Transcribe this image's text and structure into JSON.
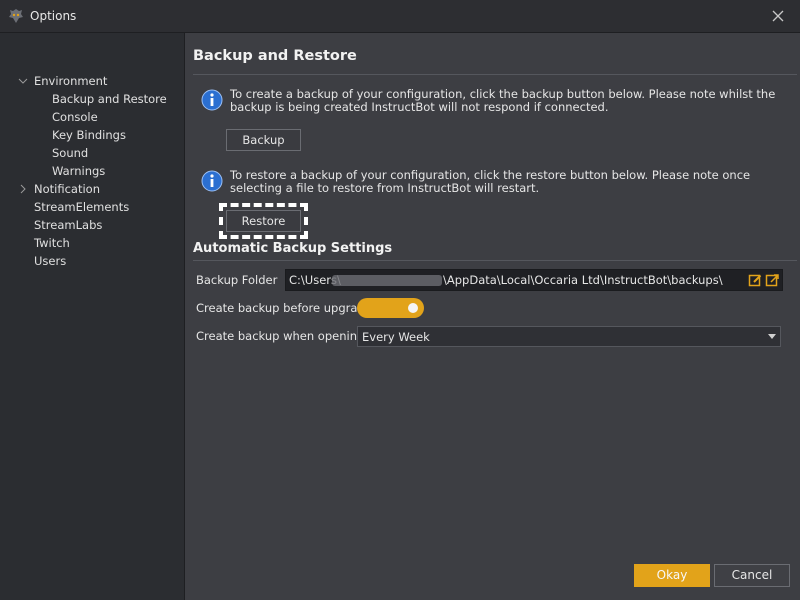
{
  "window": {
    "title": "Options",
    "app_icon": "instructbot-logo-icon",
    "close_icon": "close-icon"
  },
  "sidebar": {
    "items": [
      {
        "label": "Environment",
        "expanded": true
      },
      {
        "label": "Backup and Restore"
      },
      {
        "label": "Console"
      },
      {
        "label": "Key Bindings"
      },
      {
        "label": "Sound"
      },
      {
        "label": "Warnings"
      },
      {
        "label": "Notification",
        "expanded": false
      },
      {
        "label": "StreamElements"
      },
      {
        "label": "StreamLabs"
      },
      {
        "label": "Twitch"
      },
      {
        "label": "Users"
      }
    ]
  },
  "main": {
    "heading": "Backup and Restore",
    "backup_info": "To create a backup of your configuration, click the backup button below. Please note whilst the backup is being created InstructBot will not respond if connected.",
    "backup_button": "Backup",
    "restore_info": "To restore a backup of your configuration, click the restore button below. Please note once selecting a file to restore from InstructBot will restart.",
    "restore_button": "Restore",
    "auto_heading": "Automatic Backup Settings",
    "backup_folder_label": "Backup Folder",
    "backup_folder_prefix": "C:\\Users\\",
    "backup_folder_suffix": "\\AppData\\Local\\Occaria Ltd\\InstructBot\\backups\\",
    "create_before_upgrading_label": "Create backup before upgrading",
    "create_before_upgrading_on": true,
    "create_when_opening_label": "Create backup when opening",
    "create_when_opening_value": "Every Week"
  },
  "footer": {
    "okay_button": "Okay",
    "cancel_button": "Cancel"
  },
  "colors": {
    "accent": "#e2a31a",
    "info_blue": "#2b6fd1"
  }
}
